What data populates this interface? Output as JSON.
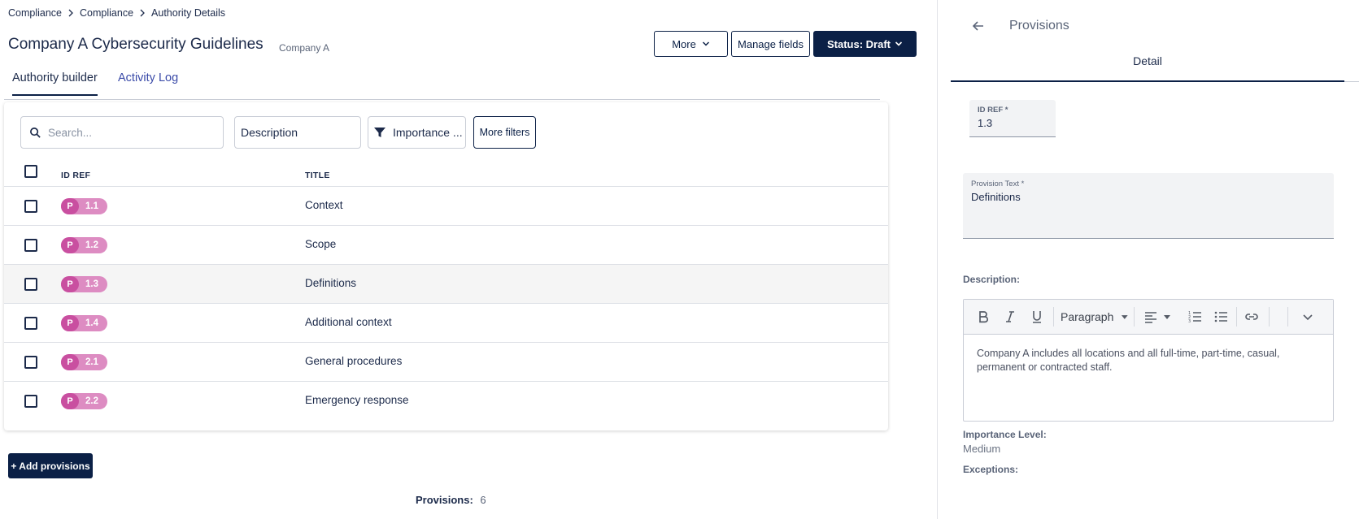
{
  "breadcrumb": {
    "items": [
      "Compliance",
      "Compliance",
      "Authority Details"
    ]
  },
  "header": {
    "title": "Company A Cybersecurity Guidelines",
    "subtitle": "Company A",
    "more_label": "More",
    "manage_label": "Manage fields",
    "status_label": "Status: Draft"
  },
  "tabs": [
    {
      "label": "Authority builder",
      "active": true
    },
    {
      "label": "Activity Log",
      "active": false
    }
  ],
  "filters": {
    "search_placeholder": "Search...",
    "description": "Description",
    "importance": "Importance ...",
    "more_filters": "More filters"
  },
  "table": {
    "columns": [
      "ID REF",
      "TITLE"
    ],
    "rows": [
      {
        "prefix": "P",
        "id": "1.1",
        "title": "Context",
        "selected": false
      },
      {
        "prefix": "P",
        "id": "1.2",
        "title": "Scope",
        "selected": false
      },
      {
        "prefix": "P",
        "id": "1.3",
        "title": "Definitions",
        "selected": true
      },
      {
        "prefix": "P",
        "id": "1.4",
        "title": "Additional context",
        "selected": false
      },
      {
        "prefix": "P",
        "id": "2.1",
        "title": "General procedures",
        "selected": false
      },
      {
        "prefix": "P",
        "id": "2.2",
        "title": "Emergency response",
        "selected": false
      }
    ]
  },
  "actions": {
    "add_label": "+ Add provisions"
  },
  "footer": {
    "count_label": "Provisions:",
    "count_value": "6"
  },
  "panel": {
    "title": "Provisions",
    "tab": "Detail",
    "id_ref_label": "ID REF *",
    "id_ref_value": "1.3",
    "provision_text_label": "Provision Text *",
    "provision_text_value": "Definitions",
    "description_label": "Description:",
    "toolbar": {
      "paragraph": "Paragraph",
      "icons": [
        "bold-icon",
        "italic-icon",
        "underline-icon",
        "align-icon",
        "numbered-list-icon",
        "bullet-list-icon",
        "link-icon",
        "chevron-down-icon"
      ]
    },
    "description_text": "Company A includes all locations and all full-time, part-time, casual, permanent or contracted staff.",
    "importance_label": "Importance Level:",
    "importance_value": "Medium",
    "exceptions_label": "Exceptions:"
  },
  "colors": {
    "primary": "#0b2046",
    "tab_link": "#3a4aa8",
    "pill_dark": "#c94fa0",
    "pill_light": "#dd8cc2",
    "selected_row": "#f5f5f5"
  }
}
